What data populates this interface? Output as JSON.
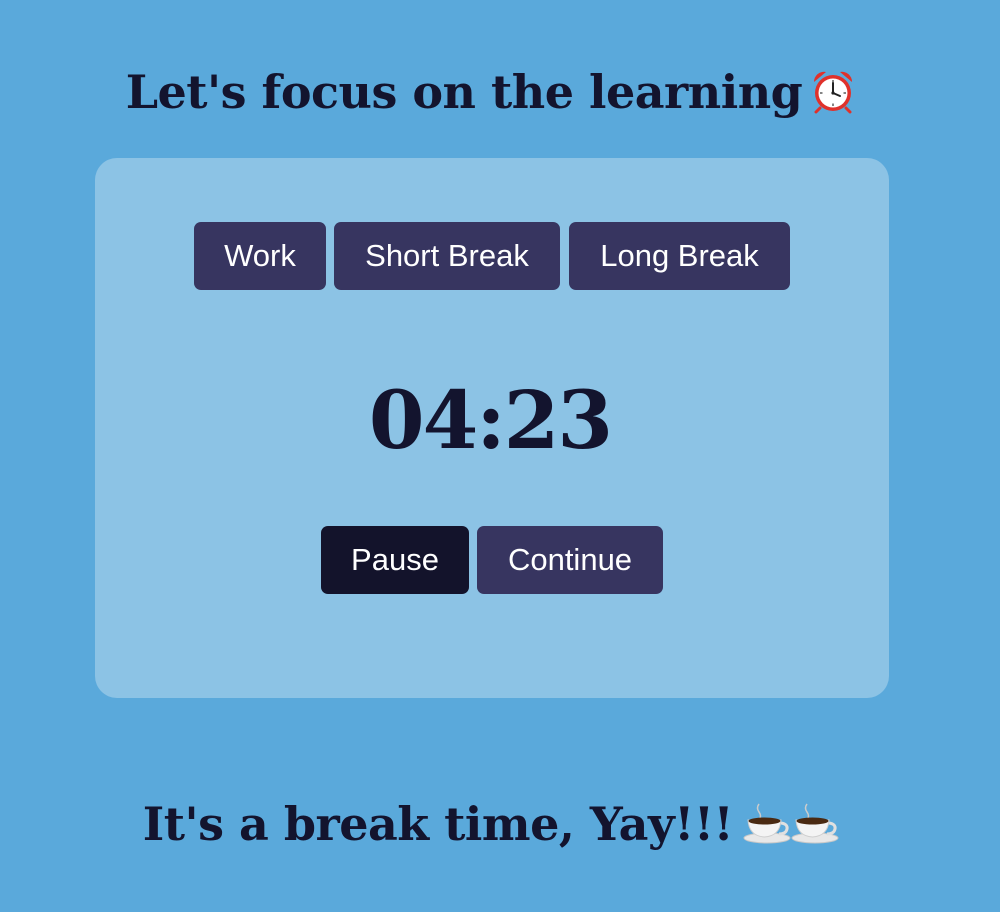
{
  "page": {
    "title": "Let's focus on the learning",
    "title_icon": "alarm-clock-icon",
    "break_message": "It's a break time, Yay!!!",
    "break_icons": [
      "coffee-cup-icon",
      "coffee-cup-icon"
    ]
  },
  "timer": {
    "modes": [
      {
        "label": "Work"
      },
      {
        "label": "Short Break"
      },
      {
        "label": "Long Break"
      }
    ],
    "display": "04:23",
    "controls": {
      "pause_label": "Pause",
      "continue_label": "Continue"
    }
  },
  "colors": {
    "background": "#5aa9db",
    "card": "#8cc3e5",
    "button": "#373560",
    "button_active": "#13132b",
    "text_dark": "#13142e"
  }
}
